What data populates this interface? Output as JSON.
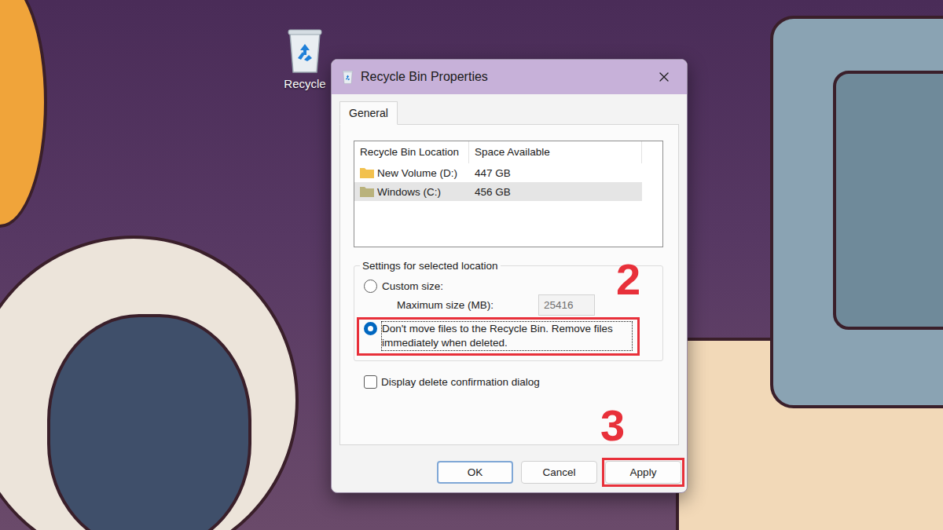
{
  "desktop": {
    "icons": [
      {
        "label": "Recycle"
      }
    ]
  },
  "window": {
    "title": "Recycle Bin Properties"
  },
  "tabs": [
    {
      "label": "General",
      "selected": true
    }
  ],
  "location_list": {
    "columns": [
      "Recycle Bin Location",
      "Space Available"
    ],
    "rows": [
      {
        "location": "New Volume (D:)",
        "space": "447 GB",
        "selected": false,
        "color": "#f2c14e"
      },
      {
        "location": "Windows (C:)",
        "space": "456 GB",
        "selected": true,
        "color": "#b9b27c"
      }
    ]
  },
  "settings": {
    "title": "Settings for selected location",
    "options": [
      {
        "label": "Custom size:",
        "selected": false,
        "marker": null
      },
      {
        "label": "Don't move files to the Recycle Bin. Remove files immediately when deleted.",
        "selected": true,
        "marker": "2"
      }
    ],
    "max_size": {
      "label": "Maximum size (MB):",
      "value": "25416",
      "disabled": true
    },
    "confirm": {
      "label": "Display delete confirmation dialog",
      "checked": false
    }
  },
  "buttons": [
    {
      "label": "OK",
      "default": true,
      "marker": null
    },
    {
      "label": "Cancel",
      "default": false,
      "marker": null
    },
    {
      "label": "Apply",
      "default": false,
      "marker": "3"
    }
  ]
}
